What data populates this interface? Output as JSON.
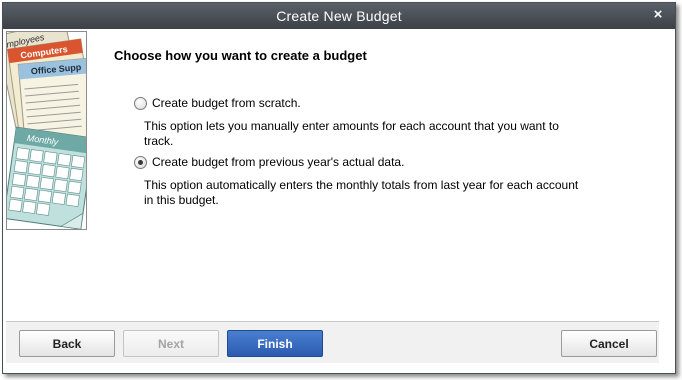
{
  "window": {
    "title": "Create New Budget",
    "close_symbol": "×"
  },
  "illustration": {
    "icon": "budget-paperwork-calendar-icon",
    "tab_text": "mployees",
    "computers_text": "Computers",
    "office_text": "Office Supp",
    "calendar_text": "Monthly"
  },
  "main": {
    "heading": "Choose how you want to create a budget",
    "options": [
      {
        "label": "Create budget from scratch.",
        "description": "This option lets you manually enter amounts for each account that you want to track.",
        "selected": false
      },
      {
        "label": "Create budget from previous year's actual data.",
        "description": "This option automatically enters the monthly totals from last year for each account in this budget.",
        "selected": true
      }
    ]
  },
  "buttons": {
    "back": "Back",
    "next": "Next",
    "finish": "Finish",
    "cancel": "Cancel"
  },
  "colors": {
    "titlebar": "#4a4f55",
    "primary_button": "#2b5bb0",
    "footer": "#f1f1f1"
  }
}
